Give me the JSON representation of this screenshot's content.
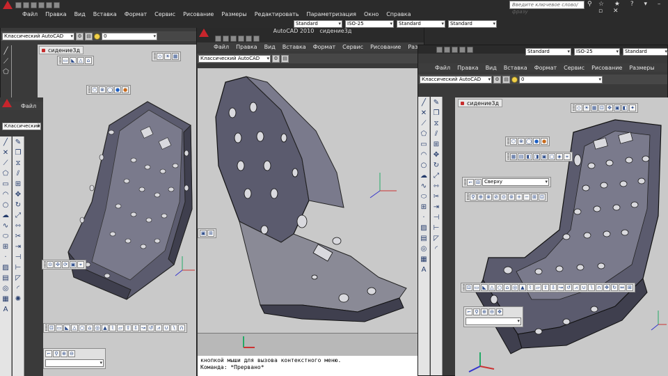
{
  "app": {
    "title": "AutoCAD 2010",
    "drawing": "сидение3д",
    "search_placeholder": "Введите ключевое слово/фразу",
    "logo_icon": "autocad-logo-icon"
  },
  "menu": [
    "Файл",
    "Правка",
    "Вид",
    "Вставка",
    "Формат",
    "Сервис",
    "Рисование",
    "Размеры",
    "Редактировать",
    "Параметризация",
    "Окно",
    "Справка"
  ],
  "toolbars": {
    "workspace": "Классический AutoCAD",
    "workspace_short": "Классический А",
    "layer": "0",
    "text_style": "Standard",
    "dim_style": "ISO-25",
    "table_style": "Standard",
    "mleader_style": "Standard"
  },
  "views": {
    "view_combo": "Сверху"
  },
  "tabs": {
    "drawing_tab": "сидение3д"
  },
  "command_line": {
    "line1": "кнопкой мыши для вызова контекстного меню.",
    "line2": "Команда: *Прервано*"
  },
  "colors": {
    "viewport_bg": "#c9c9c9",
    "seat_fill": "#5b5b6e",
    "seat_light": "#7a7a8c",
    "seat_dark": "#3f3f4e",
    "hole": "#d9d9de",
    "accent_red": "#c8252c"
  }
}
